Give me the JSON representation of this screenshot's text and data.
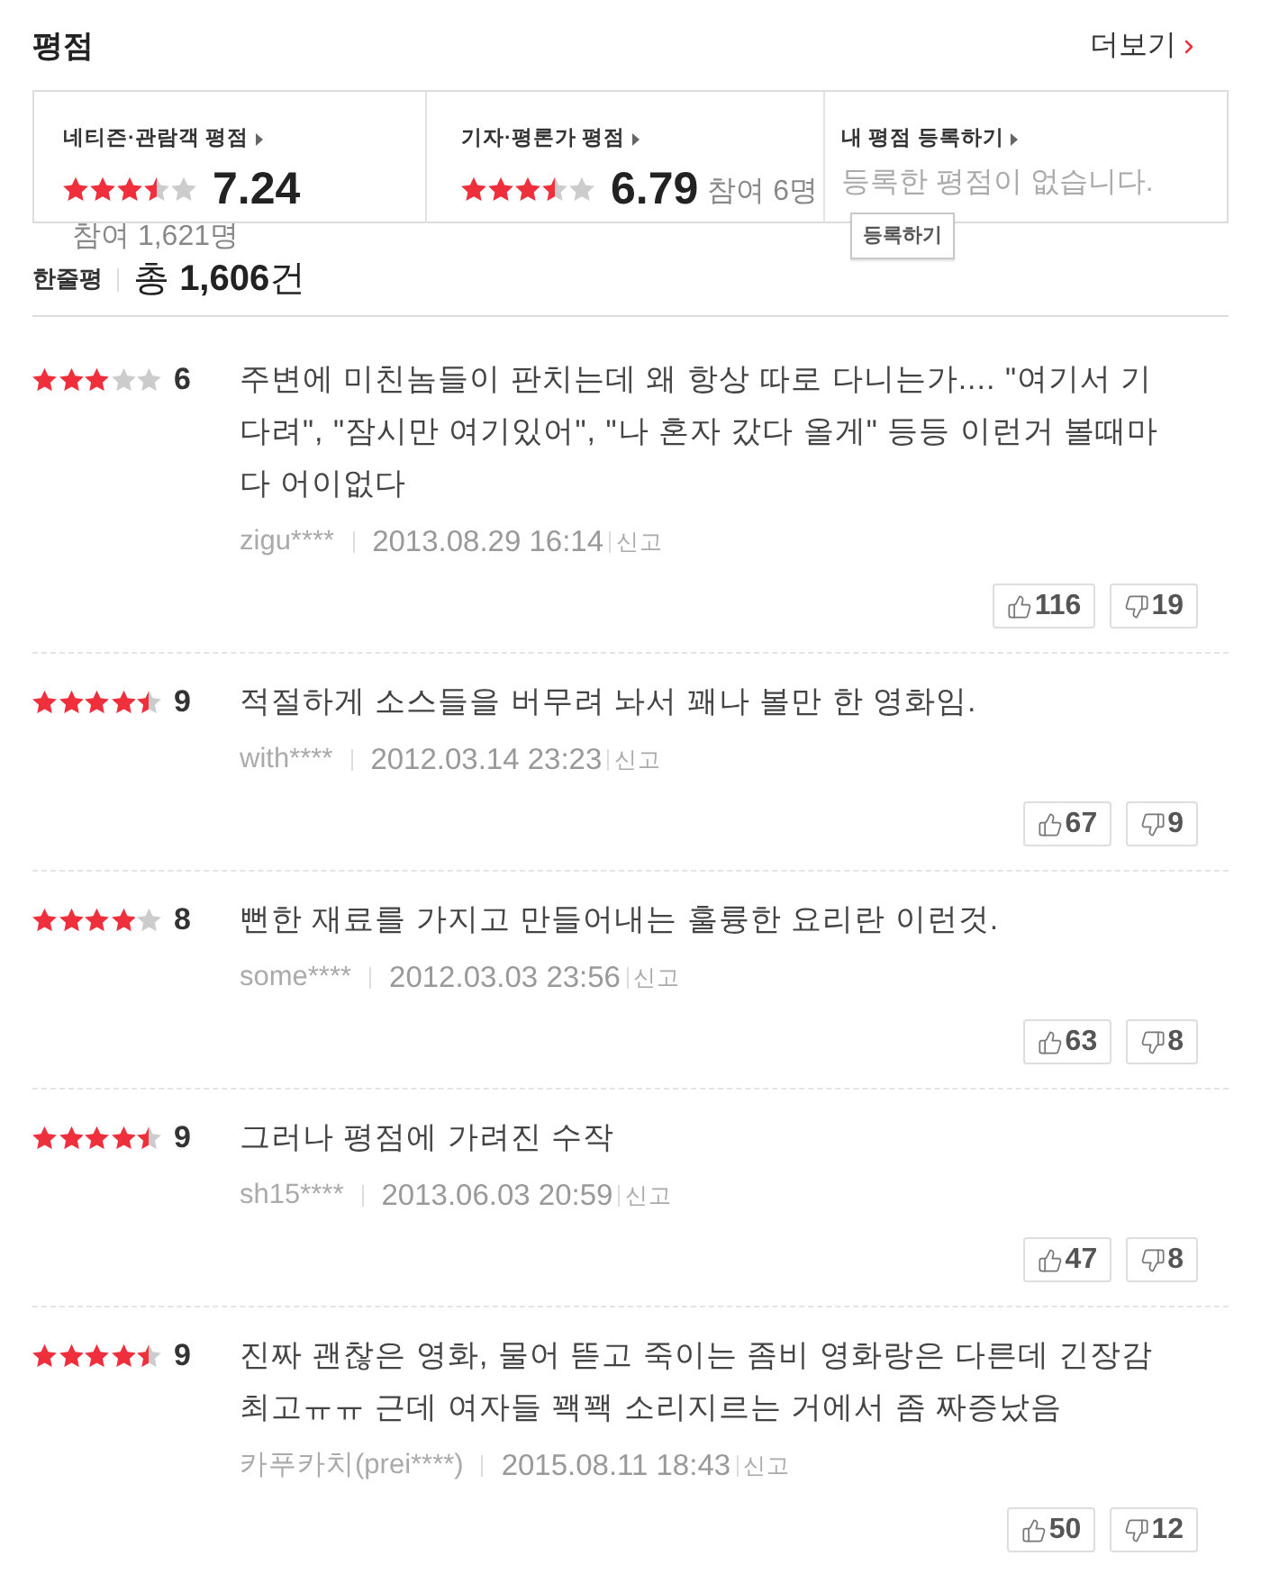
{
  "section": {
    "title": "평점",
    "more_link": "더보기"
  },
  "summary": [
    {
      "kind": "rating",
      "label": "네티즌·관람객 평점",
      "stars": 3.5,
      "score": "7.24",
      "participants": "참여 1,621명"
    },
    {
      "kind": "rating",
      "label": "기자·평론가 평점",
      "stars": 3.5,
      "score": "6.79",
      "participants": "참여 6명"
    },
    {
      "kind": "register",
      "label": "내 평점 등록하기",
      "message": "등록한 평점이 없습니다.",
      "button": "등록하기"
    }
  ],
  "reviews_header": {
    "label": "한줄평",
    "total": "총 **1,606**건"
  },
  "reviews": [
    {
      "stars": 3,
      "score": "6",
      "text": "주변에 미친놈들이 판치는데 왜 항상 따로 다니는가.... \"여기서 기다려\", \"잠시만 여기있어\", \"나 혼자 갔다 올게\" 등등 이런거 볼때마다 어이없다",
      "user": "zigu****",
      "date": "2013.08.29 16:14",
      "report": "신고",
      "likes": "116",
      "dislikes": "19"
    },
    {
      "stars": 4.5,
      "score": "9",
      "text": "적절하게 소스들을 버무려 놔서 꽤나 볼만 한 영화임.",
      "user": "with****",
      "date": "2012.03.14 23:23",
      "report": "신고",
      "likes": "67",
      "dislikes": "9"
    },
    {
      "stars": 4,
      "score": "8",
      "text": "뻔한 재료를 가지고 만들어내는 훌륭한 요리란 이런것.",
      "user": "some****",
      "date": "2012.03.03 23:56",
      "report": "신고",
      "likes": "63",
      "dislikes": "8"
    },
    {
      "stars": 4.5,
      "score": "9",
      "text": "그러나 평점에 가려진 수작",
      "user": "sh15****",
      "date": "2013.06.03 20:59",
      "report": "신고",
      "likes": "47",
      "dislikes": "8"
    },
    {
      "stars": 4.5,
      "score": "9",
      "text": "진짜 괜찮은 영화, 물어 뜯고 죽이는 좀비 영화랑은 다른데 긴장감 최고ㅠㅠ 근데 여자들 꽥꽥 소리지르는 거에서 좀 짜증났음",
      "user": "카푸카치(prei****)",
      "date": "2015.08.11 18:43",
      "report": "신고",
      "likes": "50",
      "dislikes": "12"
    }
  ]
}
